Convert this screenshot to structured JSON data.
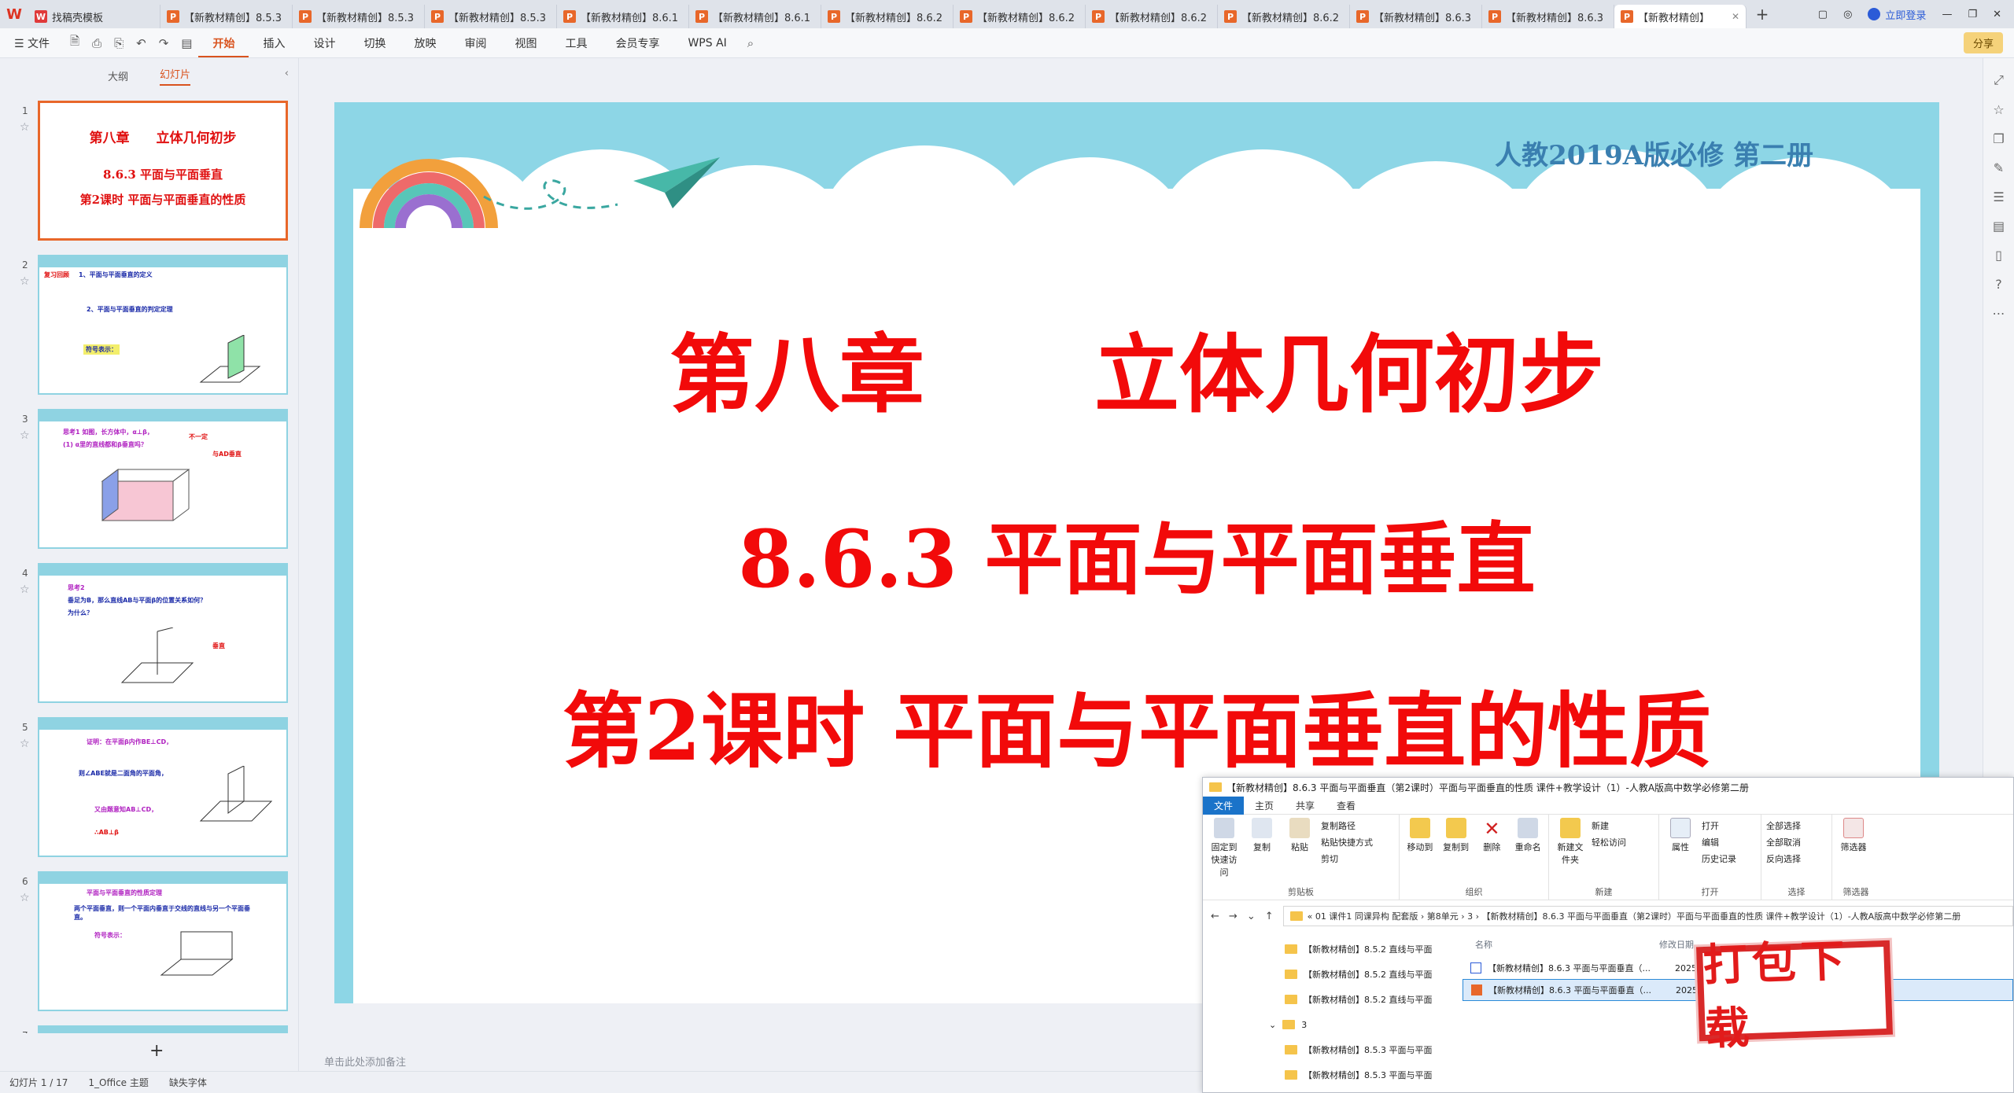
{
  "tabs": [
    {
      "label": "找稿壳模板"
    },
    {
      "label": "【新教材精创】8.5.3"
    },
    {
      "label": "【新教材精创】8.5.3"
    },
    {
      "label": "【新教材精创】8.5.3"
    },
    {
      "label": "【新教材精创】8.6.1"
    },
    {
      "label": "【新教材精创】8.6.1"
    },
    {
      "label": "【新教材精创】8.6.2"
    },
    {
      "label": "【新教材精创】8.6.2"
    },
    {
      "label": "【新教材精创】8.6.2"
    },
    {
      "label": "【新教材精创】8.6.2"
    },
    {
      "label": "【新教材精创】8.6.3"
    },
    {
      "label": "【新教材精创】8.6.3"
    },
    {
      "label": "【新教材精创】"
    }
  ],
  "titlebar": {
    "login": "立即登录",
    "share": "分享"
  },
  "menu": {
    "file": "文件",
    "items": [
      "开始",
      "插入",
      "设计",
      "切换",
      "放映",
      "审阅",
      "视图",
      "工具",
      "会员专享",
      "WPS AI"
    ]
  },
  "sidebar": {
    "tab_outline": "大纲",
    "tab_slides": "幻灯片"
  },
  "slide": {
    "subtitle": "人教2019A版必修 第二册",
    "line1": "第八章　　立体几何初步",
    "line2": "8.6.3 平面与平面垂直",
    "line3": "第2课时 平面与平面垂直的性质"
  },
  "thumbs": [
    {
      "num": "1",
      "a": "第八章　　立体几何初步",
      "b": "8.6.3 平面与平面垂直",
      "c": "第2课时 平面与平面垂直的性质"
    },
    {
      "num": "2",
      "a": "复习回顾",
      "b": "1、平面与平面垂直的定义",
      "c": "2、平面与平面垂直的判定定理",
      "d": "符号表示："
    },
    {
      "num": "3",
      "a": "思考1  如图，长方体中，α⊥β，",
      "b": "(1) α里的直线都和β垂直吗？",
      "c": "不一定",
      "d": "与AD垂直"
    },
    {
      "num": "4",
      "a": "思考2",
      "b": "垂足为B，那么直线AB与平面β的位置关系如何？",
      "c": "为什么？",
      "d": "垂直"
    },
    {
      "num": "5",
      "a": "证明：在平面β内作BE⊥CD，",
      "b": "则∠ABE就是二面角的平面角，",
      "c": "又由题意知AB⊥CD，",
      "d": "∴AB⊥β"
    },
    {
      "num": "6",
      "a": "平面与平面垂直的性质定理",
      "b": "两个平面垂直，则一个平面内垂直于交线的直线与另一个平面垂直。",
      "c": "符号表示："
    },
    {
      "num": "7"
    }
  ],
  "notes": "单击此处添加备注",
  "status": {
    "slide": "幻灯片 1 / 17",
    "theme": "1_Office 主题",
    "font": "缺失字体"
  },
  "explorer": {
    "title": "【新教材精创】8.6.3 平面与平面垂直（第2课时）平面与平面垂直的性质 课件+教学设计（1）-人教A版高中数学必修第二册",
    "tabs": [
      "文件",
      "主页",
      "共享",
      "查看"
    ],
    "ribbon": {
      "pin": "固定到快速访问",
      "copy": "复制",
      "paste": "粘贴",
      "copypath": "复制路径",
      "pasteshortcut": "粘贴快捷方式",
      "cut": "剪切",
      "clipboard": "剪贴板",
      "moveto": "移动到",
      "copyto": "复制到",
      "delete": "删除",
      "rename": "重命名",
      "organize": "组织",
      "newfolder": "新建文件夹",
      "newitem": "新建",
      "easyaccess": "轻松访问",
      "new": "新建",
      "props": "属性",
      "open": "打开",
      "edit": "编辑",
      "history": "历史记录",
      "opengrp": "打开",
      "selectall": "全部选择",
      "selectnone": "全部取消",
      "invert": "反向选择",
      "select": "选择",
      "filter": "筛选器",
      "filtergrp": "筛选器"
    },
    "address": "« 01 课件1 同课异构 配套版 › 第8单元 › 3 › 【新教材精创】8.6.3 平面与平面垂直（第2课时）平面与平面垂直的性质 课件+教学设计（1）-人教A版高中数学必修第二册",
    "tree": [
      "【新教材精创】8.5.2 直线与平面",
      "【新教材精创】8.5.2 直线与平面",
      "【新教材精创】8.5.2 直线与平面",
      "3",
      "【新教材精创】8.5.3 平面与平面",
      "【新教材精创】8.5.3 平面与平面"
    ],
    "col_name": "名称",
    "col_date": "修改日期",
    "files": [
      {
        "name": "【新教材精创】8.6.3 平面与平面垂直（...",
        "date": "2025"
      },
      {
        "name": "【新教材精创】8.6.3 平面与平面垂直（...",
        "date": "2025"
      }
    ]
  },
  "download": "打包下载",
  "colors": {
    "accent": "#d9531e",
    "slide_red": "#f20a0a",
    "slide_band": "#8dd6e6"
  }
}
